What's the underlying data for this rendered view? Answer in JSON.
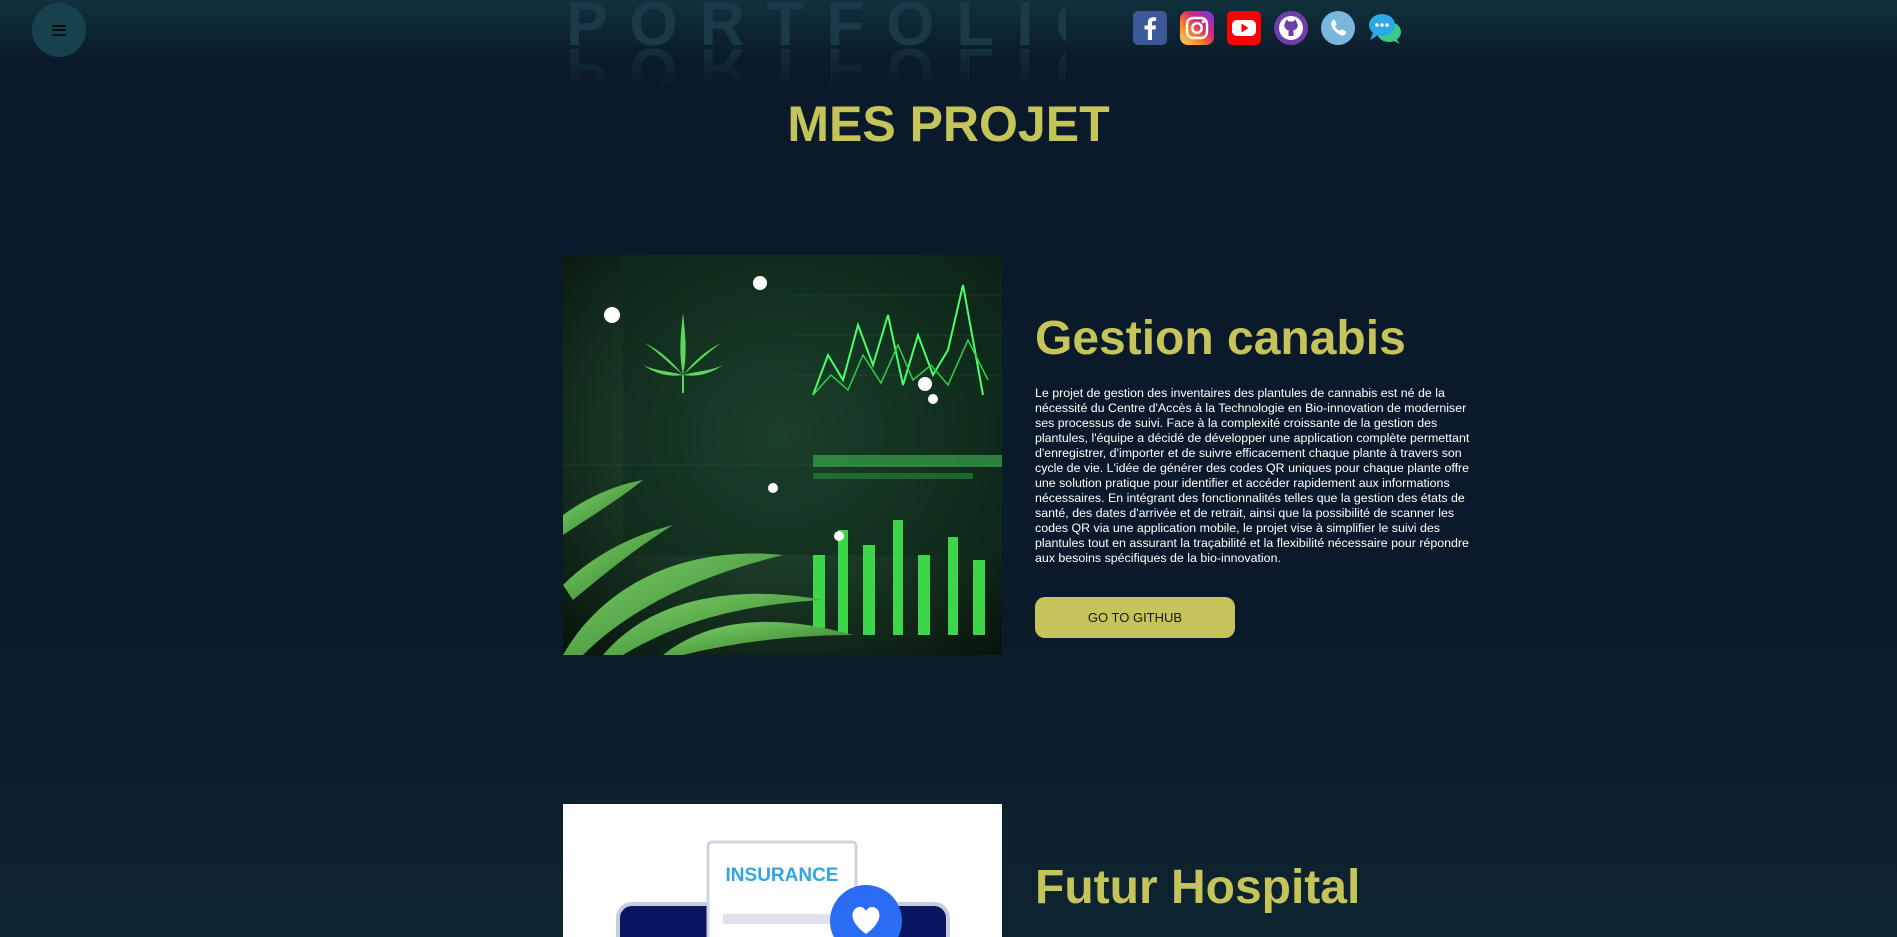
{
  "header": {
    "logo_text": "PORTFOLIO",
    "menu_icon": "hamburger-menu-icon",
    "socials": [
      {
        "name": "facebook",
        "icon": "facebook-icon",
        "color": "#3b5998"
      },
      {
        "name": "instagram",
        "icon": "instagram-icon",
        "color": "#e1306c"
      },
      {
        "name": "youtube",
        "icon": "youtube-icon",
        "color": "#ff0000"
      },
      {
        "name": "github",
        "icon": "github-icon",
        "color": "#6e3fa8"
      },
      {
        "name": "phone",
        "icon": "phone-icon",
        "color": "#5aa9d6"
      },
      {
        "name": "chat",
        "icon": "chat-icon",
        "color": "#2bb1e6"
      }
    ]
  },
  "section": {
    "title": "MES PROJET"
  },
  "projects": [
    {
      "title": "Gestion canabis",
      "description": "Le projet de gestion des inventaires des plantules de cannabis est né de la nécessité du Centre d'Accès à la Technologie en Bio-innovation de moderniser ses processus de suivi. Face à la complexité croissante de la gestion des plantules, l'équipe a décidé de développer une application complète permettant d'enregistrer, d'importer et de suivre efficacement chaque plante à travers son cycle de vie. L'idée de générer des codes QR uniques pour chaque plante offre une solution pratique pour identifier et accéder rapidement aux informations nécessaires. En intégrant des fonctionnalités telles que la gestion des états de santé, des dates d'arrivée et de retrait, ainsi que la possibilité de scanner les codes QR via une application mobile, le projet vise à simplifier le suivi des plantules tout en assurant la traçabilité et la flexibilité nécessaire pour répondre aux besoins spécifiques de la bio-innovation.",
      "button_label": "GO TO GITHUB"
    },
    {
      "title": "Futur Hospital",
      "image_label": "INSURANCE"
    }
  ],
  "colors": {
    "accent": "#c5c45b",
    "background": "#0b1a2a"
  }
}
